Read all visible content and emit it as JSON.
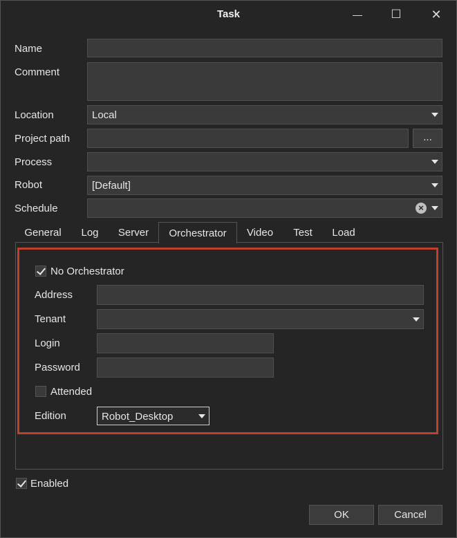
{
  "window": {
    "title": "Task",
    "minimize_glyph": "—",
    "maximize_glyph": "☐",
    "close_glyph": "✕"
  },
  "form": {
    "name": {
      "label": "Name",
      "value": ""
    },
    "comment": {
      "label": "Comment",
      "value": ""
    },
    "location": {
      "label": "Location",
      "value": "Local"
    },
    "project_path": {
      "label": "Project path",
      "value": "",
      "browse_label": "..."
    },
    "process": {
      "label": "Process",
      "value": ""
    },
    "robot": {
      "label": "Robot",
      "value": "[Default]"
    },
    "schedule": {
      "label": "Schedule",
      "value": "",
      "clear_glyph": "×"
    }
  },
  "tabs": [
    {
      "label": "General"
    },
    {
      "label": "Log"
    },
    {
      "label": "Server"
    },
    {
      "label": "Orchestrator",
      "active": true
    },
    {
      "label": "Video"
    },
    {
      "label": "Test"
    },
    {
      "label": "Load"
    }
  ],
  "orchestrator": {
    "no_orchestrator": {
      "label": "No Orchestrator",
      "checked": true
    },
    "address": {
      "label": "Address",
      "value": ""
    },
    "tenant": {
      "label": "Tenant",
      "value": ""
    },
    "login": {
      "label": "Login",
      "value": ""
    },
    "password": {
      "label": "Password",
      "value": ""
    },
    "attended": {
      "label": "Attended",
      "checked": false
    },
    "edition": {
      "label": "Edition",
      "value": "Robot_Desktop"
    },
    "highlight_color": "#c0402c"
  },
  "footer": {
    "enabled": {
      "label": "Enabled",
      "checked": true
    },
    "ok_label": "OK",
    "cancel_label": "Cancel"
  }
}
